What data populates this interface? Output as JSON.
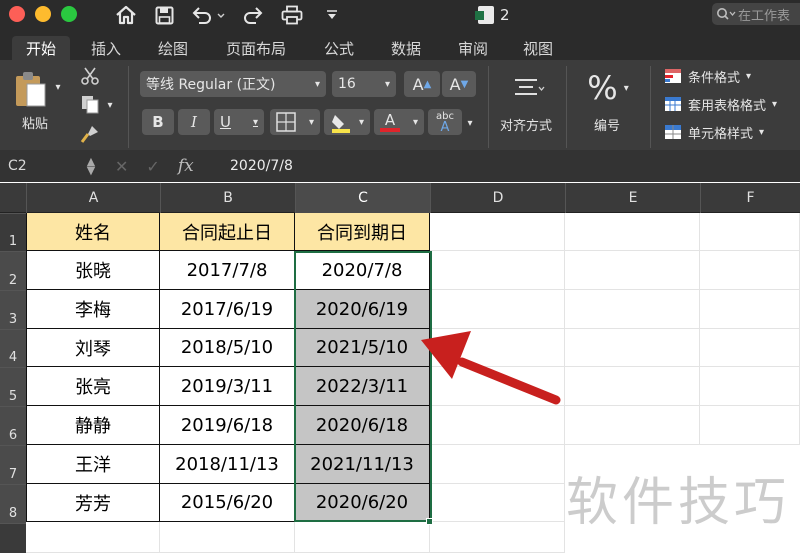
{
  "window": {
    "title": "2",
    "search_placeholder": "在工作表"
  },
  "tabs": [
    "开始",
    "插入",
    "绘图",
    "页面布局",
    "公式",
    "数据",
    "审阅",
    "视图"
  ],
  "ribbon": {
    "paste_label": "粘贴",
    "font_name": "等线 Regular (正文)",
    "font_size": "16",
    "grow_font": "A",
    "shrink_font": "A",
    "bold": "B",
    "italic": "I",
    "underline": "U",
    "font_color_glyph": "A",
    "phonetic_top": "abc",
    "phonetic_bottom": "A",
    "align_label": "对齐方式",
    "number_symbol": "%",
    "number_label": "编号",
    "conditional_format": "条件格式",
    "table_format": "套用表格格式",
    "cell_style": "单元格样式",
    "font_color": "#e0242b",
    "fill_color": "#f7e34a"
  },
  "formula_bar": {
    "name_box": "C2",
    "fx": "fx",
    "value": "2020/7/8"
  },
  "columns": [
    "A",
    "B",
    "C",
    "D",
    "E",
    "F"
  ],
  "rows": [
    "1",
    "2",
    "3",
    "4",
    "5",
    "6",
    "7",
    "8"
  ],
  "table": {
    "headers": [
      "姓名",
      "合同起止日",
      "合同到期日"
    ],
    "rows": [
      [
        "张晓",
        "2017/7/8",
        "2020/7/8"
      ],
      [
        "李梅",
        "2017/6/19",
        "2020/6/19"
      ],
      [
        "刘琴",
        "2018/5/10",
        "2021/5/10"
      ],
      [
        "张亮",
        "2019/3/11",
        "2022/3/11"
      ],
      [
        "静静",
        "2019/6/18",
        "2020/6/18"
      ],
      [
        "王洋",
        "2018/11/13",
        "2021/11/13"
      ],
      [
        "芳芳",
        "2015/6/20",
        "2020/6/20"
      ]
    ]
  },
  "watermark": "软件技巧",
  "colors": {
    "header_fill": "#fde6a4",
    "selection_fill": "#c5c5c5",
    "selection_border": "#1e6d43",
    "arrow": "#c8201e"
  }
}
